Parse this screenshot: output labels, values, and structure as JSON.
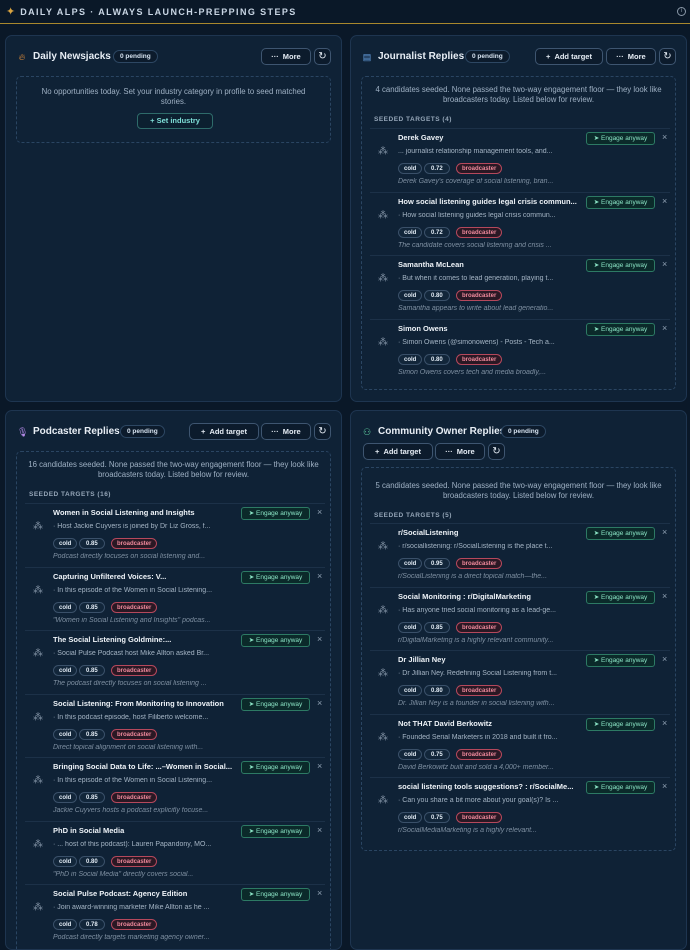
{
  "header": {
    "title": "DAILY ALPS · ALWAYS LAUNCH-PREPPING STEPS",
    "info_icon": "info-icon"
  },
  "colors": {
    "accent": "#c9a441",
    "engage": "#8ae3c4",
    "broadcaster": "#f08a9c"
  },
  "common": {
    "more": "More",
    "add_target": "Add target",
    "engage": "Engage anyway",
    "cold": "cold",
    "broadcaster": "broadcaster",
    "close": "×"
  },
  "newsjacks": {
    "title": "Daily Newsjacks",
    "pending": "0 pending",
    "message": "No opportunities today. Set your industry category in profile to seed matched stories.",
    "set_industry": "Set industry"
  },
  "journalist": {
    "title": "Journalist Replies",
    "pending": "0 pending",
    "message": "4 candidates seeded. None passed the two-way engagement floor — they look like broadcasters today. Listed below for review.",
    "seeded_label": "SEEDED TARGETS (4)",
    "items": [
      {
        "name": "Derek Gavey",
        "snippet": "... journalist relationship management tools, and...",
        "score": "0.72",
        "reason": "Derek Gavey's coverage of social listening, bran..."
      },
      {
        "name": "How social listening guides legal crisis commun...",
        "snippet": "· How social listening guides legal crisis commun...",
        "score": "0.72",
        "reason": "The candidate covers social listening and crisis ..."
      },
      {
        "name": "Samantha McLean",
        "snippet": "· But when it comes to lead generation, playing t...",
        "score": "0.80",
        "reason": "Samantha appears to write about lead generatio..."
      },
      {
        "name": "Simon Owens",
        "snippet": "· Simon Owens (@simonowens) - Posts - Tech a...",
        "score": "0.80",
        "reason": "Simon Owens covers tech and media broadly,..."
      }
    ]
  },
  "podcaster": {
    "title": "Podcaster Replies",
    "pending": "0 pending",
    "message": "16 candidates seeded. None passed the two-way engagement floor — they look like broadcasters today. Listed below for review.",
    "seeded_label": "SEEDED TARGETS (16)",
    "items": [
      {
        "name": "Women in Social Listening and Insights",
        "snippet": "· Host Jackie Cuyvers is joined by Dr Liz Gross, f...",
        "score": "0.85",
        "reason": "Podcast directly focuses on social listening and..."
      },
      {
        "name": "Capturing Unfiltered Voices: V...",
        "snippet": "· In this episode of the Women in Social Listening...",
        "score": "0.85",
        "reason": "\"Women in Social Listening and Insights\" podcas..."
      },
      {
        "name": "The Social Listening Goldmine:...",
        "snippet": "· Social Pulse Podcast host Mike Allton asked Br...",
        "score": "0.85",
        "reason": "The podcast directly focuses on social listening ..."
      },
      {
        "name": "Social Listening: From Monitoring to Innovation",
        "snippet": "· In this podcast episode, host Filiberto welcome...",
        "score": "0.85",
        "reason": "Direct topical alignment on social listening with..."
      },
      {
        "name": "Bringing Social Data to Life: ...–Women in Social...",
        "snippet": "· In this episode of the Women in Social Listening...",
        "score": "0.85",
        "reason": "Jackie Cuyvers hosts a podcast explicitly focuse..."
      },
      {
        "name": "PhD in Social Media",
        "snippet": "· ... host of this podcast): Lauren Papandony, MO...",
        "score": "0.80",
        "reason": "\"PhD in Social Media\" directly covers social..."
      },
      {
        "name": "Social Pulse Podcast: Agency Edition",
        "snippet": "· Join award-winning marketer Mike Allton as he ...",
        "score": "0.78",
        "reason": "Podcast directly targets marketing agency owner..."
      }
    ]
  },
  "community": {
    "title": "Community Owner Replies",
    "pending": "0 pending",
    "message": "5 candidates seeded. None passed the two-way engagement floor — they look like broadcasters today. Listed below for review.",
    "seeded_label": "SEEDED TARGETS (5)",
    "items": [
      {
        "name": "r/SocialListening",
        "snippet": "· r/sociallistening: r/SocialListening is the place t...",
        "score": "0.95",
        "reason": "r/SocialListening is a direct topical match—the..."
      },
      {
        "name": "Social Monitoring : r/DigitalMarketing",
        "snippet": "· Has anyone tried social monitoring as a lead-ge...",
        "score": "0.85",
        "reason": "r/DigitalMarketing is a highly relevant community..."
      },
      {
        "name": "Dr Jillian Ney",
        "snippet": "· Dr Jillian Ney. Redefining Social Listening from t...",
        "score": "0.80",
        "reason": "Dr. Jillian Ney is a founder in social listening with..."
      },
      {
        "name": "Not THAT David Berkowitz",
        "snippet": "· Founded Serial Marketers in 2018 and built it fro...",
        "score": "0.75",
        "reason": "David Berkowitz built and sold a 4,000+ member..."
      },
      {
        "name": "social listening tools suggestions? : r/SocialMe...",
        "snippet": "· Can you share a bit more about your goal(s)? Is ...",
        "score": "0.75",
        "reason": "r/SocialMediaMarketing is a highly relevant..."
      }
    ]
  }
}
